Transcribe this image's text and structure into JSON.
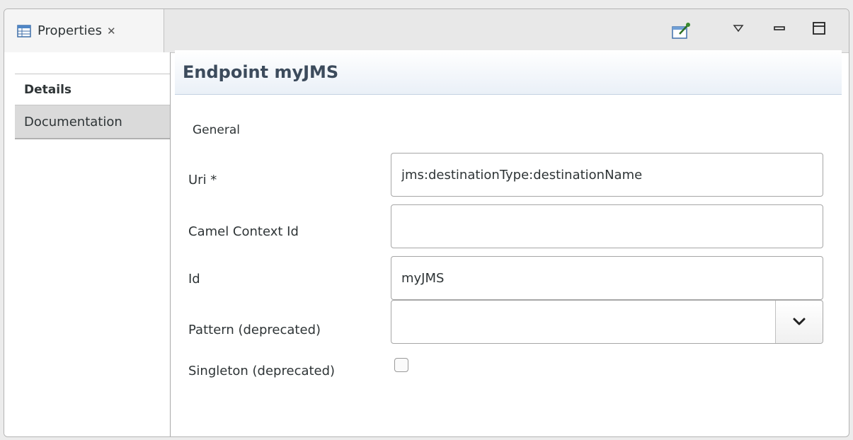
{
  "view_tab": {
    "label": "Properties",
    "close_glyph": "✕",
    "icon": "properties-table-icon"
  },
  "toolbar": {
    "pin_icon": "pin-to-selection-icon",
    "menu_icon": "view-menu-chevron-icon",
    "minimize_icon": "minimize-icon",
    "maximize_icon": "maximize-icon"
  },
  "sidebar": {
    "items": [
      {
        "label": "Details"
      },
      {
        "label": "Documentation"
      }
    ]
  },
  "header": {
    "title": "Endpoint myJMS"
  },
  "form": {
    "section": "General",
    "uri": {
      "label": "Uri *",
      "value": "jms:destinationType:destinationName"
    },
    "camel_context_id": {
      "label": "Camel Context Id",
      "value": ""
    },
    "id": {
      "label": "Id",
      "value": "myJMS"
    },
    "pattern": {
      "label": "Pattern (deprecated)",
      "value": ""
    },
    "singleton": {
      "label": "Singleton (deprecated)",
      "checked": false
    }
  },
  "colors": {
    "header_text": "#3c4b5c",
    "header_gradient_end": "#eaf0f7",
    "pin_icon_green": "#3a8a2e"
  }
}
